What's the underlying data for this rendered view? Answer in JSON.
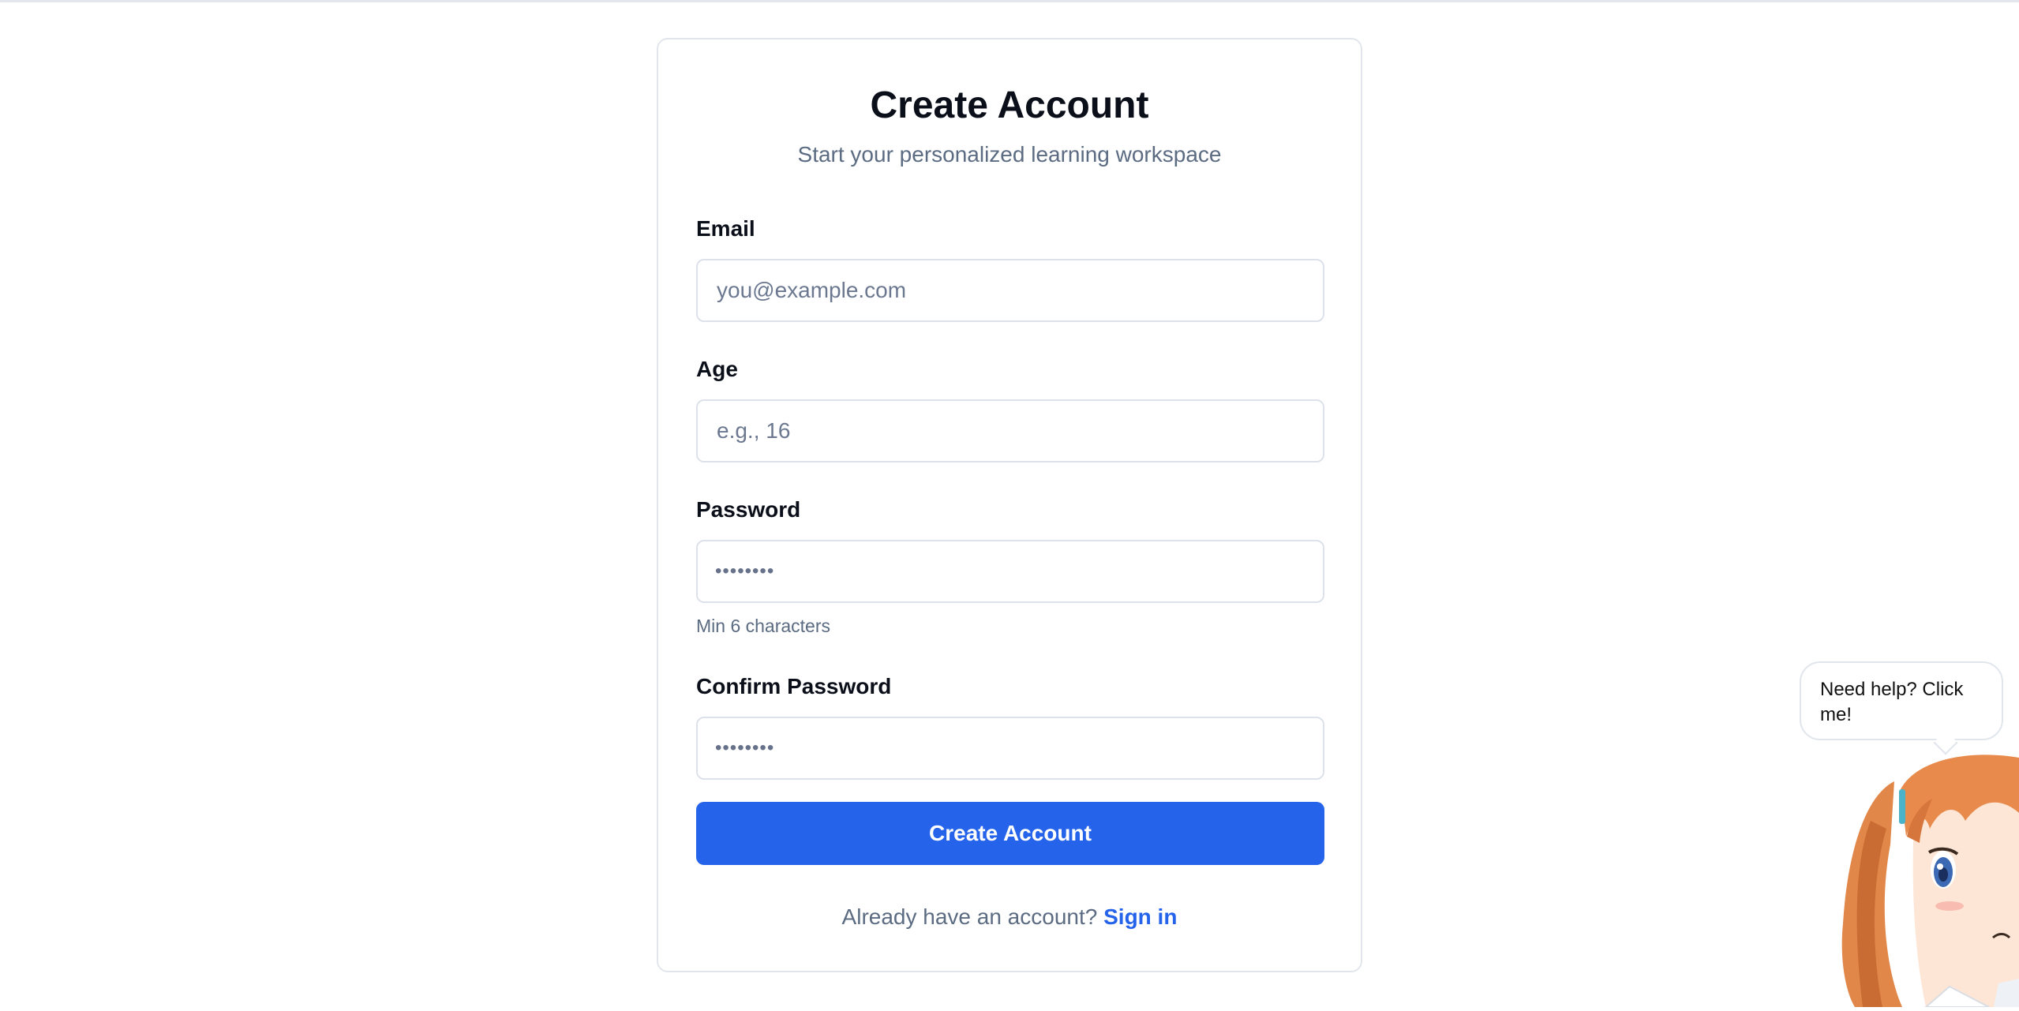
{
  "header": {
    "title": "Create Account",
    "subtitle": "Start your personalized learning workspace"
  },
  "form": {
    "email": {
      "label": "Email",
      "placeholder": "you@example.com",
      "value": ""
    },
    "age": {
      "label": "Age",
      "placeholder": "e.g., 16",
      "value": ""
    },
    "password": {
      "label": "Password",
      "masked": "••••••••",
      "hint": "Min 6 characters"
    },
    "confirm_password": {
      "label": "Confirm Password",
      "masked": "••••••••"
    },
    "submit_label": "Create Account"
  },
  "footer": {
    "prompt": "Already have an account?",
    "link": "Sign in"
  },
  "assistant": {
    "bubble_text": "Need help? Click me!",
    "icon": "anime-girl-mascot"
  },
  "colors": {
    "primary": "#2563eb",
    "muted_text": "#5b6b82",
    "border": "#dde2ea"
  }
}
